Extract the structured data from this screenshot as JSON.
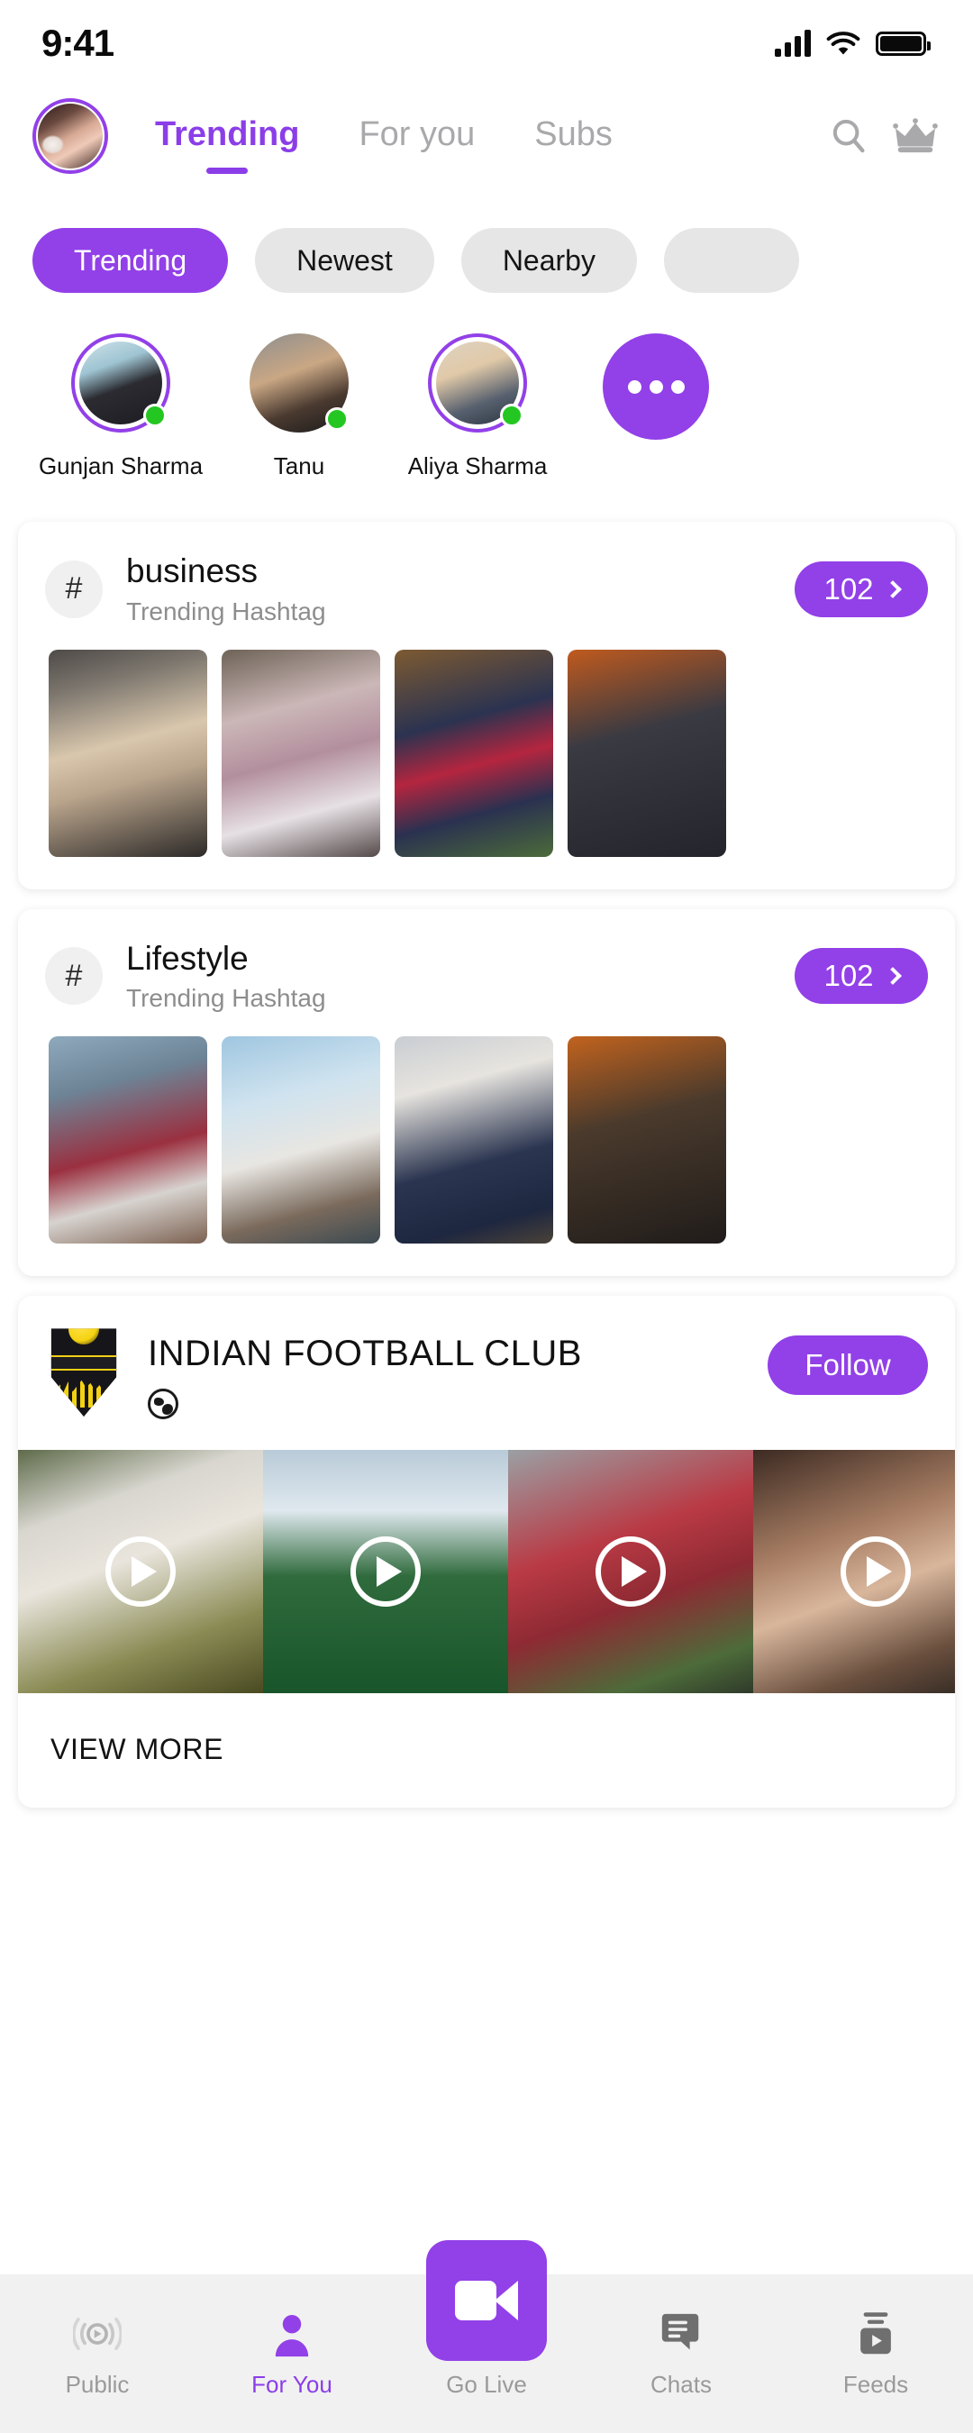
{
  "status_bar": {
    "time": "9:41",
    "signal_icon": "cellular-signal-icon",
    "wifi_icon": "wifi-icon",
    "battery_icon": "battery-icon"
  },
  "header": {
    "avatar_name": "profile-avatar",
    "tabs": [
      {
        "label": "Trending",
        "active": true
      },
      {
        "label": "For you",
        "active": false
      },
      {
        "label": "Subs",
        "active": false
      }
    ],
    "search_icon": "search-icon",
    "crown_icon": "crown-icon"
  },
  "filters": {
    "chips": [
      {
        "label": "Trending",
        "active": true
      },
      {
        "label": "Newest",
        "active": false
      },
      {
        "label": "Nearby",
        "active": false
      },
      {
        "label": "",
        "active": false
      }
    ]
  },
  "stories": {
    "items": [
      {
        "name": "Gunjan Sharma",
        "online": true,
        "ringed": true
      },
      {
        "name": "Tanu",
        "online": true,
        "ringed": false
      },
      {
        "name": "Aliya Sharma",
        "online": true,
        "ringed": true
      }
    ],
    "more_label": "more-stories-button"
  },
  "hashtag_cards": [
    {
      "hash_symbol": "#",
      "title": "business",
      "subtitle": "Trending Hashtag",
      "count": "102",
      "thumbnails": [
        "t-b1",
        "t-b2",
        "t-b3",
        "t-b4"
      ]
    },
    {
      "hash_symbol": "#",
      "title": "Lifestyle",
      "subtitle": "Trending Hashtag",
      "count": "102",
      "thumbnails": [
        "t-l1",
        "t-l2",
        "t-l3",
        "t-l4"
      ]
    }
  ],
  "club_card": {
    "logo_alt": "windy-city-rampage-fc-logo",
    "name": "INDIAN FOOTBALL CLUB",
    "globe_icon": "globe-icon",
    "follow_label": "Follow",
    "videos": [
      "v1",
      "v2",
      "v3",
      "v4"
    ],
    "view_more_label": "VIEW MORE"
  },
  "bottom_nav": {
    "items": [
      {
        "label": "Public",
        "icon": "broadcast-icon",
        "active": false
      },
      {
        "label": "For You",
        "icon": "person-icon",
        "active": true
      },
      {
        "label": "Go Live",
        "icon": "video-camera-icon",
        "active": false
      },
      {
        "label": "Chats",
        "icon": "chat-bubble-icon",
        "active": false
      },
      {
        "label": "Feeds",
        "icon": "feed-play-icon",
        "active": false
      }
    ]
  },
  "colors": {
    "accent": "#9240e8",
    "accent_text": "#8b3ee8",
    "chip_inactive": "#e6e6e6",
    "online_dot": "#24c721",
    "nav_bg": "#f1f1f1",
    "muted_text": "#9a9a9a"
  }
}
